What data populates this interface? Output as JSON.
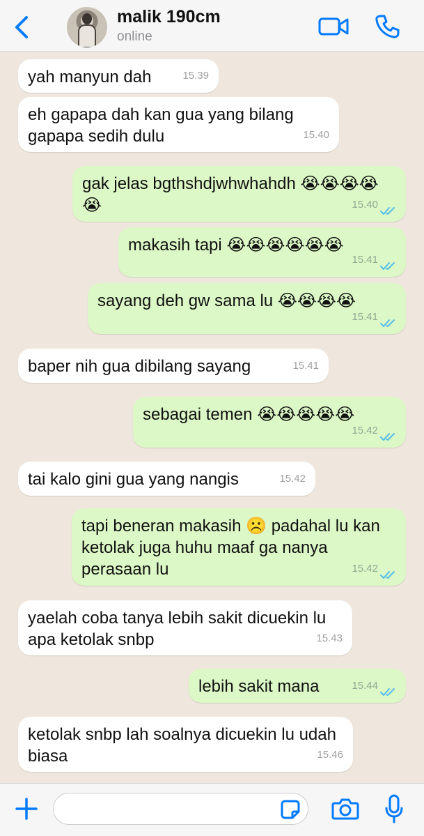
{
  "header": {
    "back_icon": "chevron-left-icon",
    "contact_name": "malik 190cm",
    "status": "online",
    "video_icon": "video-camera-icon",
    "call_icon": "phone-icon"
  },
  "messages": [
    {
      "dir": "in",
      "text": "yah manyun dah",
      "time": "15.39"
    },
    {
      "dir": "in",
      "text": "eh gapapa dah kan gua yang bilang gapapa sedih dulu",
      "time": "15.40"
    },
    {
      "dir": "out",
      "text": "gak jelas bgthshdjwhwhahdh 😭😭😭😭😭",
      "time": "15.40",
      "read": true
    },
    {
      "dir": "out",
      "text": "makasih tapi 😭😭😭😭😭😭",
      "time": "15.41",
      "read": true
    },
    {
      "dir": "out",
      "text": "sayang deh gw sama lu 😭😭😭😭",
      "time": "15.41",
      "read": true
    },
    {
      "dir": "in",
      "text": "baper nih gua dibilang sayang",
      "time": "15.41"
    },
    {
      "dir": "out",
      "text": "sebagai temen 😭😭😭😭😭",
      "time": "15.42",
      "read": true
    },
    {
      "dir": "in",
      "text": "tai kalo gini gua yang nangis",
      "time": "15.42"
    },
    {
      "dir": "out",
      "text": "tapi beneran makasih ☹️ padahal lu kan ketolak juga huhu maaf ga nanya perasaan lu",
      "time": "15.42",
      "read": true
    },
    {
      "dir": "in",
      "text": "yaelah coba tanya lebih sakit dicuekin lu apa ketolak snbp",
      "time": "15.43"
    },
    {
      "dir": "out",
      "text": "lebih sakit mana",
      "time": "15.44",
      "read": true
    },
    {
      "dir": "in",
      "text": "ketolak snbp lah soalnya dicuekin lu udah biasa",
      "time": "15.46"
    }
  ],
  "composer": {
    "plus_icon": "plus-icon",
    "input_value": "",
    "sticker_icon": "sticker-icon",
    "camera_icon": "camera-icon",
    "mic_icon": "microphone-icon"
  },
  "colors": {
    "accent": "#007aff",
    "incoming_bubble": "#ffffff",
    "outgoing_bubble": "#dcf8c6",
    "read_ticks": "#53bdeb",
    "chat_background": "#efe7dd"
  }
}
